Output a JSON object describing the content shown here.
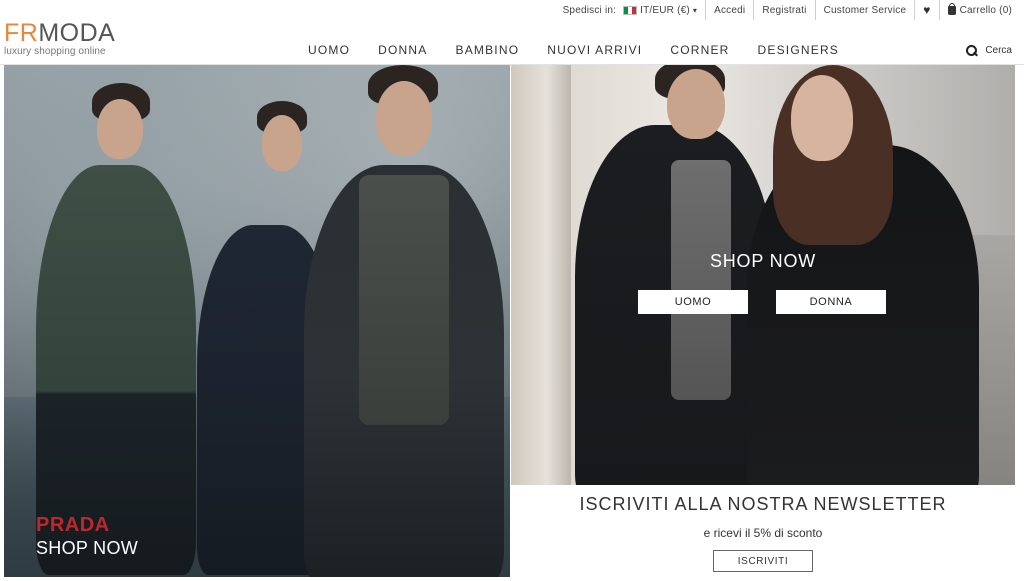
{
  "topbar": {
    "ship_label": "Spedisci in:",
    "region": "IT/EUR (€)",
    "login": "Accedi",
    "register": "Registrati",
    "customer_service": "Customer Service",
    "cart": "Carrello (0)"
  },
  "logo": {
    "accent_text": "FR",
    "main_text": "MODA",
    "tagline": "luxury shopping online"
  },
  "nav": {
    "items": [
      "UOMO",
      "DONNA",
      "BAMBINO",
      "NUOVI ARRIVI",
      "CORNER",
      "DESIGNERS"
    ],
    "search_label": "Cerca"
  },
  "banner_left": {
    "brand": "PRADA",
    "cta": "SHOP NOW"
  },
  "banner_right": {
    "cta": "SHOP NOW",
    "buttons": [
      "UOMO",
      "DONNA"
    ]
  },
  "newsletter": {
    "title": "ISCRIVITI ALLA NOSTRA NEWSLETTER",
    "subtitle": "e ricevi il 5% di sconto",
    "button": "ISCRIVITI"
  },
  "colors": {
    "logo_accent": "#e8873a",
    "brand_red": "#c0272d",
    "flag_green": "#009246",
    "flag_white": "#ffffff",
    "flag_red": "#ce2b37"
  },
  "icons": [
    "flag-it-icon",
    "caret-down-icon",
    "heart-icon",
    "bag-icon",
    "search-icon"
  ]
}
